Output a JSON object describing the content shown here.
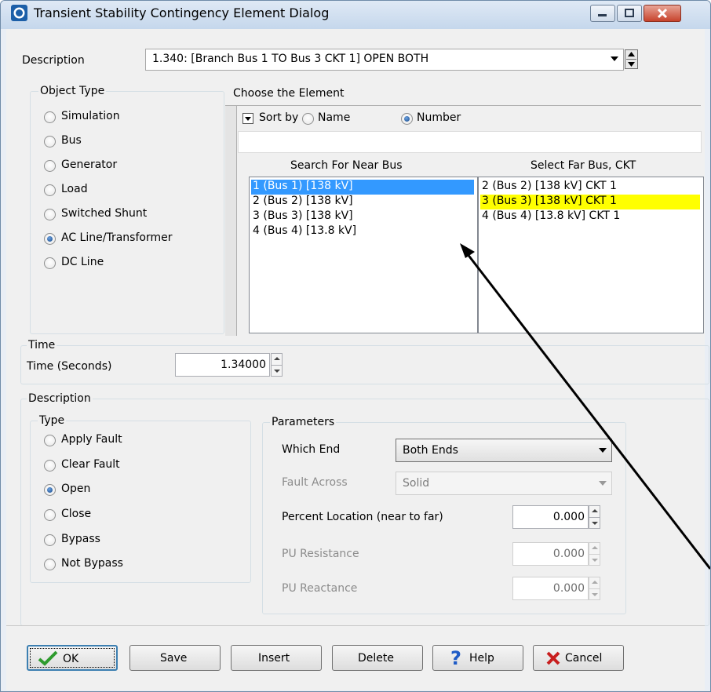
{
  "window": {
    "title": "Transient Stability Contingency Element Dialog"
  },
  "description": {
    "label": "Description",
    "value": "1.340: [Branch Bus 1  TO  Bus 3 CKT 1] OPEN BOTH"
  },
  "object_type": {
    "legend": "Object Type",
    "options": [
      {
        "label": "Simulation",
        "selected": false
      },
      {
        "label": "Bus",
        "selected": false
      },
      {
        "label": "Generator",
        "selected": false
      },
      {
        "label": "Load",
        "selected": false
      },
      {
        "label": "Switched Shunt",
        "selected": false
      },
      {
        "label": "AC Line/Transformer",
        "selected": true
      },
      {
        "label": "DC Line",
        "selected": false
      }
    ]
  },
  "element_chooser": {
    "header": "Choose the Element",
    "sort_by_label": "Sort by",
    "sort_name_label": "Name",
    "sort_number_label": "Number",
    "sort_selected": "Number",
    "filter_value": "",
    "near_bus": {
      "header": "Search For Near Bus",
      "items": [
        "1 (Bus 1)  [138 kV]",
        "2 (Bus 2)  [138 kV]",
        "3 (Bus 3)  [138 kV]",
        "4 (Bus 4)  [13.8 kV]"
      ],
      "selected_index": 0
    },
    "far_bus": {
      "header": "Select Far Bus, CKT",
      "items": [
        "2 (Bus 2) [138 kV] CKT  1",
        "3 (Bus 3) [138 kV] CKT  1",
        "4 (Bus 4) [13.8 kV] CKT  1"
      ],
      "selected_index": 1
    }
  },
  "time": {
    "legend": "Time",
    "label": "Time (Seconds)",
    "value": "1.34000"
  },
  "action": {
    "legend": "Description",
    "type_legend": "Type",
    "types": [
      {
        "label": "Apply Fault",
        "selected": false
      },
      {
        "label": "Clear Fault",
        "selected": false
      },
      {
        "label": "Open",
        "selected": true
      },
      {
        "label": "Close",
        "selected": false
      },
      {
        "label": "Bypass",
        "selected": false
      },
      {
        "label": "Not Bypass",
        "selected": false
      }
    ]
  },
  "parameters": {
    "legend": "Parameters",
    "which_end_label": "Which End",
    "which_end_value": "Both Ends",
    "fault_across_label": "Fault Across",
    "fault_across_value": "Solid",
    "percent_location_label": "Percent Location (near to far)",
    "percent_location_value": "0.000",
    "pu_resistance_label": "PU Resistance",
    "pu_resistance_value": "0.000",
    "pu_reactance_label": "PU Reactance",
    "pu_reactance_value": "0.000"
  },
  "buttons": {
    "ok": "OK",
    "save": "Save",
    "insert": "Insert",
    "delete": "Delete",
    "help": "Help",
    "cancel": "Cancel"
  },
  "colors": {
    "selection_blue": "#3399ff",
    "selection_yellow": "#ffff00",
    "help_icon": "#1e5bc6",
    "cancel_icon": "#c81e1e",
    "ok_icon": "#2e9b2e"
  }
}
